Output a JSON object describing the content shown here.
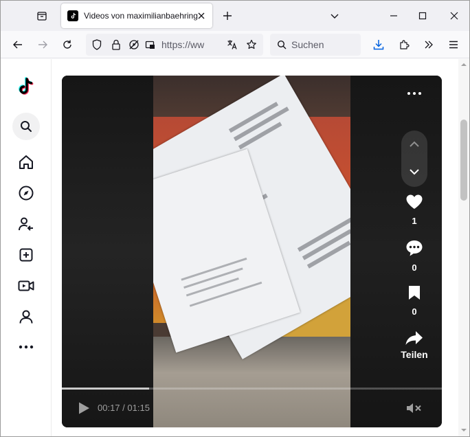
{
  "browser": {
    "tab_title": "Videos von maximilianbaehring",
    "url": "https://www.tiktok.com",
    "search_placeholder": "Suchen"
  },
  "video": {
    "current_time": "00:17",
    "duration": "01:15",
    "time_separator": " / ",
    "progress": 0.23,
    "likes": "1",
    "comments": "0",
    "saves": "0",
    "share_label": "Teilen"
  },
  "sidebar": {
    "items": [
      "search-icon",
      "home-icon",
      "explore-icon",
      "following-icon",
      "upload-icon",
      "live-icon",
      "profile-icon",
      "more-icon"
    ]
  },
  "colors": {
    "tiktok_cyan": "#25f4ee",
    "tiktok_red": "#fe2c55",
    "firefox_blue": "#0061e0"
  }
}
